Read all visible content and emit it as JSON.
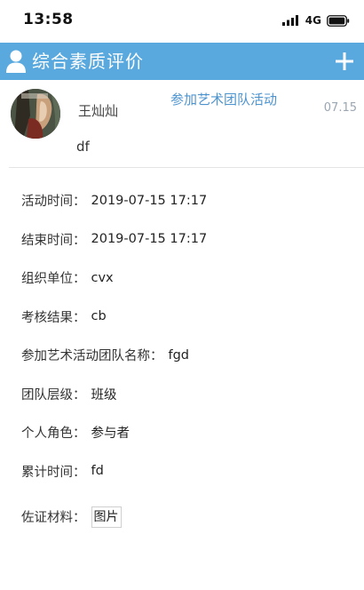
{
  "status_bar": {
    "time": "13:58",
    "network": "4G"
  },
  "header": {
    "title": "综合素质评价",
    "add_icon": "plus-icon",
    "user_icon": "user-icon"
  },
  "record": {
    "user_name": "王灿灿",
    "activity_title": "参加艺术团队活动",
    "date": "07.15",
    "note": "df"
  },
  "details": [
    {
      "label": "活动时间：",
      "value": "2019-07-15 17:17"
    },
    {
      "label": "结束时间：",
      "value": "2019-07-15 17:17"
    },
    {
      "label": "组织单位：",
      "value": "cvx"
    },
    {
      "label": "考核结果：",
      "value": "cb"
    },
    {
      "label": "参加艺术活动团队名称：",
      "value": "fgd"
    },
    {
      "label": "团队层级：",
      "value": "班级"
    },
    {
      "label": "个人角色：",
      "value": "参与者"
    },
    {
      "label": "累计时间：",
      "value": "fd"
    }
  ],
  "evidence": {
    "label": "佐证材料：",
    "button_label": "图片"
  },
  "colors": {
    "header_bg": "#5aa9de",
    "activity_title": "#4d94cf",
    "date": "#9aa6b2"
  }
}
